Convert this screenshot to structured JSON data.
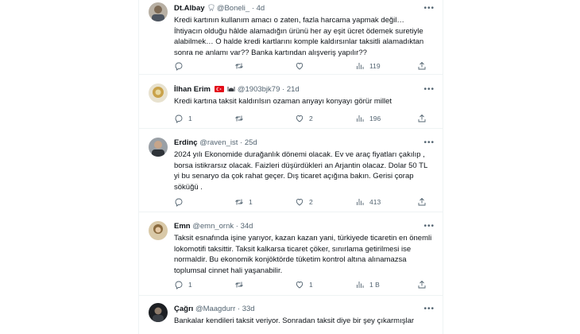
{
  "tweets": [
    {
      "name": "Dt.Albay",
      "handle": "@Boneli_",
      "time": "4d",
      "text": "Kredi kartının kullanım amacı o zaten, fazla harcama yapmak değil…\nİhtiyacın olduğu hâlde alamadığın ürünü her ay eşit ücret ödemek suretiyle alabilmek… O halde kredi kartlarını komple kaldırsınlar taksitli alamadıktan sonra ne anlamı var?? Banka kartından alışveriş yapılır??",
      "replies": "",
      "retweets": "",
      "likes": "",
      "views": "119"
    },
    {
      "name": "İlhan Erim",
      "handle": "@1903bjk79",
      "time": "21d",
      "text": "Kredi kartına  taksit kaldırılsın ozaman anyayı konyayı görür millet",
      "replies": "1",
      "retweets": "",
      "likes": "2",
      "views": "196"
    },
    {
      "name": "Erdinç",
      "handle": "@raven_ist",
      "time": "25d",
      "text": "2024 yılı Ekonomide durağanlık dönemi olacak. Ev ve araç fiyatları çakılıp , borsa istikrarsız olacak. Faizleri düşürdükleri an Arjantin olacaz. Dolar 50 TL yi bu senaryo da çok rahat geçer. Dış ticaret açığına bakın. Gerisi çorap söküğü .",
      "replies": "",
      "retweets": "1",
      "likes": "2",
      "views": "413"
    },
    {
      "name": "Emn",
      "handle": "@emn_ornk",
      "time": "34d",
      "text": "Taksit esnafında işine yarıyor, kazan kazan yani, türkiyede ticaretin en önemli lokomotifi taksittir. Taksit kalkarsa ticaret çöker, sınırlama getirilmesi ise normaldir. Bu ekonomik konjöktörde tüketim kontrol altına alınamazsa toplumsal cinnet hali yaşanabilir.",
      "replies": "1",
      "retweets": "",
      "likes": "1",
      "views": "1 B"
    },
    {
      "name": "Çağrı",
      "handle": "@Maagdurr",
      "time": "33d",
      "text": "Bankalar kendileri taksit veriyor. Sonradan taksit diye bir şey çıkarmışlar",
      "replies": "",
      "retweets": "",
      "likes": "",
      "views": ""
    }
  ],
  "colors": {
    "text": "#0f1419",
    "muted": "#536471",
    "divider": "#eff3f4",
    "flag_red": "#e30a17"
  },
  "icons": {
    "reply": "reply-icon",
    "retweet": "retweet-icon",
    "like": "heart-icon",
    "views": "analytics-icon",
    "share": "share-icon",
    "more": "more-icon"
  }
}
